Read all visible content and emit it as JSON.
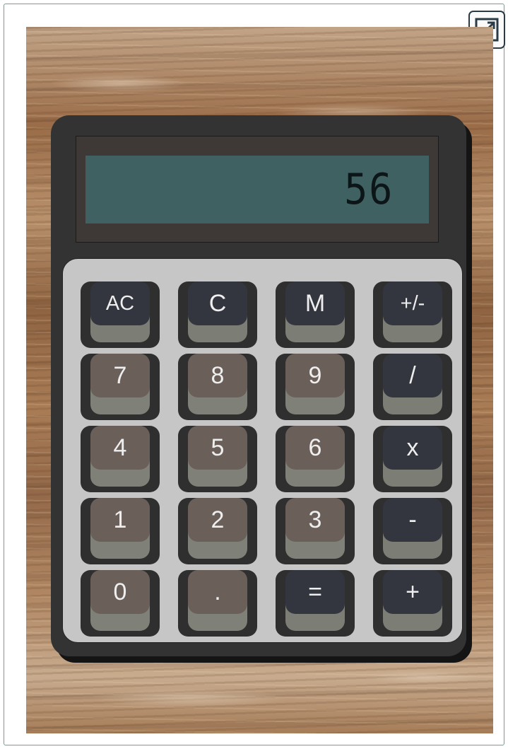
{
  "toolbar": {
    "expand_icon": "expand-icon"
  },
  "display": {
    "value": "56"
  },
  "keys": [
    {
      "label": "AC",
      "kind": "fn"
    },
    {
      "label": "C",
      "kind": "fn"
    },
    {
      "label": "M",
      "kind": "fn"
    },
    {
      "label": "+/-",
      "kind": "fn"
    },
    {
      "label": "7",
      "kind": "num"
    },
    {
      "label": "8",
      "kind": "num"
    },
    {
      "label": "9",
      "kind": "num"
    },
    {
      "label": "/",
      "kind": "fn"
    },
    {
      "label": "4",
      "kind": "num"
    },
    {
      "label": "5",
      "kind": "num"
    },
    {
      "label": "6",
      "kind": "num"
    },
    {
      "label": "x",
      "kind": "fn"
    },
    {
      "label": "1",
      "kind": "num"
    },
    {
      "label": "2",
      "kind": "num"
    },
    {
      "label": "3",
      "kind": "num"
    },
    {
      "label": "-",
      "kind": "fn"
    },
    {
      "label": "0",
      "kind": "num"
    },
    {
      "label": ".",
      "kind": "num"
    },
    {
      "label": "=",
      "kind": "fn"
    },
    {
      "label": "+",
      "kind": "fn"
    }
  ],
  "colors": {
    "frame_border": "#3cbf7a",
    "lcd_background": "#3f6162",
    "number_key": "#6b5f5a",
    "function_key": "#33353f",
    "keypad_background": "#c6c6c6"
  }
}
